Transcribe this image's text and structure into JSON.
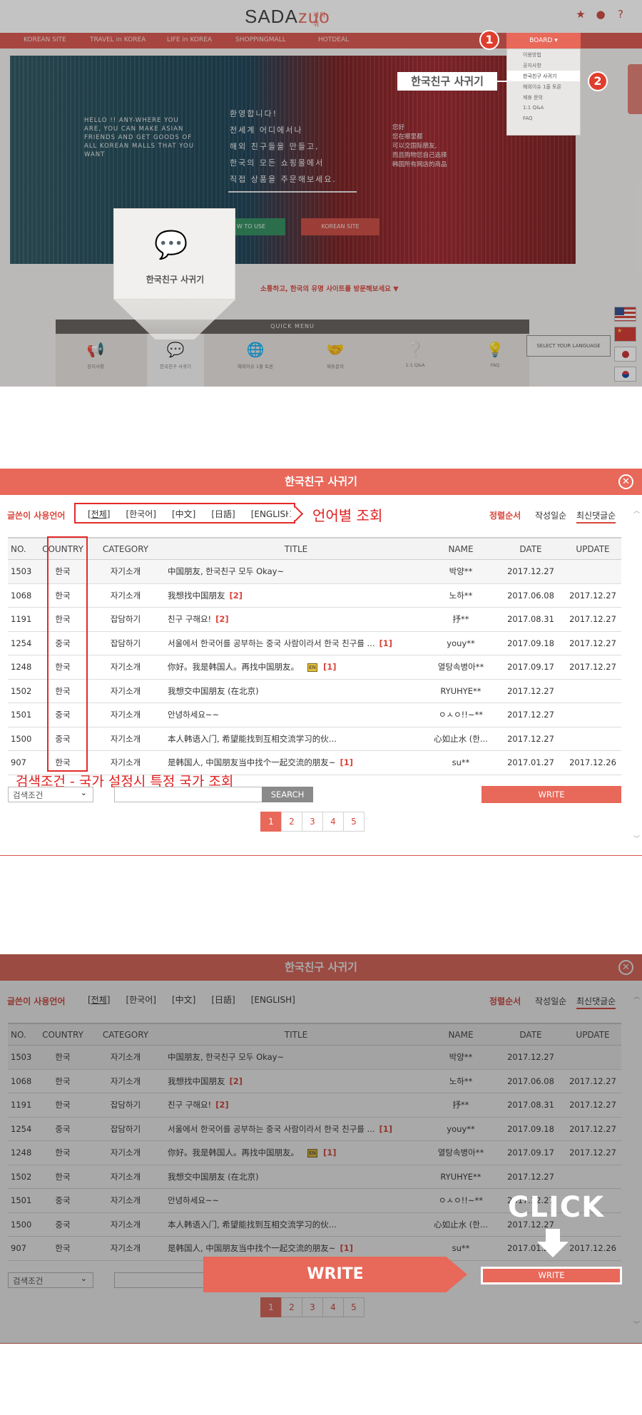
{
  "site": {
    "logo_left": "SADA",
    "logo_right": "zuo",
    "logo_small": "싸다줘",
    "nav": [
      "KOREAN SITE",
      "TRAVEL in KOREA",
      "LIFE in KOREA",
      "SHOPPINGMALL",
      "HOTDEAL"
    ],
    "board_label": "BOARD ▾",
    "board_menu": [
      "이용방법",
      "공지사항",
      "한국친구 사귀기",
      "해외이슈 1줄 토론",
      "제휴 문의",
      "1:1 Q&A",
      "FAQ"
    ],
    "step1": "1",
    "step2": "2",
    "callout": "한국친구 사귀기",
    "hero_en": "HELLO !! ANY-WHERE YOU ARE, YOU CAN MAKE ASIAN FRIENDS AND GET GOODS OF ALL KOREAN MALLS THAT YOU WANT",
    "hero_ko": [
      "환영합니다!",
      "전세계 어디에서나",
      "해외 친구들을 만들고,",
      "한국의 모든 쇼핑몰에서",
      "직접 상품을 주문해보세요."
    ],
    "hero_cn": [
      "您好",
      "您在哪里都",
      "可以交国际朋友,",
      "而且购物您自己选择",
      "韩国所有网店的商品"
    ],
    "hero_btn1": "W TO USE",
    "hero_btn2": "KOREAN SITE",
    "focus_label": "한국친구 사귀기",
    "promo": "소통하고, 한국의 유명 사이트를 방문해보세요 ▼",
    "quick_menu_title": "QUICK MENU",
    "quick_items": [
      "공지사항",
      "한국친구 사귀기",
      "해외이슈 1줄 토론",
      "제휴문의",
      "1:1 Q&A",
      "FAQ"
    ],
    "select_language": "SELECT YOUR LANGUAGE",
    "flag_cn_mark": "★"
  },
  "board": {
    "title": "한국친구 사귀기",
    "close": "✕",
    "filter_label": "글쓴이 사용언어",
    "lang_filters": [
      "[전체]",
      "[한국어]",
      "[中文]",
      "[日語]",
      "[ENGLISH]"
    ],
    "lang_note": "언어별 조회",
    "sort_label": "정렬순서",
    "sort_options": [
      "작성일순",
      "최신댓글순"
    ],
    "columns": [
      "NO.",
      "COUNTRY",
      "CATEGORY",
      "TITLE",
      "NAME",
      "DATE",
      "UPDATE"
    ],
    "rows": [
      {
        "no": "1503",
        "country": "한국",
        "cat": "자기소개",
        "title": "中国朋友, 한국친구 모두 Okay~",
        "cmt": "",
        "name": "박양**",
        "date": "2017.12.27",
        "upd": ""
      },
      {
        "no": "1068",
        "country": "한국",
        "cat": "자기소개",
        "title": "我想找中国朋友",
        "cmt": "[2]",
        "name": "노하**",
        "date": "2017.06.08",
        "upd": "2017.12.27"
      },
      {
        "no": "1191",
        "country": "한국",
        "cat": "잡담하기",
        "title": "친구 구해요!",
        "cmt": "[2]",
        "name": "抒**",
        "date": "2017.08.31",
        "upd": "2017.12.27"
      },
      {
        "no": "1254",
        "country": "중국",
        "cat": "잡담하기",
        "title": "서울에서 한국어를 공부하는 중국 사람이라서 한국 친구를 ...",
        "cmt": "[1]",
        "name": "youy**",
        "date": "2017.09.18",
        "upd": "2017.12.27"
      },
      {
        "no": "1248",
        "country": "한국",
        "cat": "자기소개",
        "title": "你好。我是韩国人。再找中国朋友。",
        "cmt": "[1]",
        "name": "열탕속병아**",
        "date": "2017.09.17",
        "upd": "2017.12.27"
      },
      {
        "no": "1502",
        "country": "한국",
        "cat": "자기소개",
        "title": "我想交中国朋友 (在北京)",
        "cmt": "",
        "name": "RYUHYE**",
        "date": "2017.12.27",
        "upd": ""
      },
      {
        "no": "1501",
        "country": "중국",
        "cat": "자기소개",
        "title": "안녕하세요~~",
        "cmt": "",
        "name": "ㅇㅅㅇ!!~**",
        "date": "2017.12.27",
        "upd": ""
      },
      {
        "no": "1500",
        "country": "중국",
        "cat": "자기소개",
        "title": "本人韩语入门, 希望能找到互相交流学习的伙...",
        "cmt": "",
        "name": "心如止水 (한...",
        "date": "2017.12.27",
        "upd": ""
      },
      {
        "no": "907",
        "country": "한국",
        "cat": "자기소개",
        "title": "是韩国人, 中国朋友当中找个一起交流的朋友~",
        "cmt": "[1]",
        "name": "su**",
        "date": "2017.01.27",
        "upd": "2017.12.26"
      }
    ],
    "country_note": "검색조건 - 국가 설정시 특정 국가 조회",
    "search_select": "검색조건",
    "search_btn": "SEARCH",
    "write_btn": "WRITE",
    "pages": [
      "1",
      "2",
      "3",
      "4",
      "5"
    ],
    "icon_badge": "EN"
  },
  "click_step": {
    "big_write": "WRITE",
    "click_label": "CLICK",
    "write_btn": "WRITE"
  },
  "colors": {
    "brand": "#e8685a",
    "brand_dark": "#d9534a",
    "annotation_red": "#e32a2a"
  }
}
